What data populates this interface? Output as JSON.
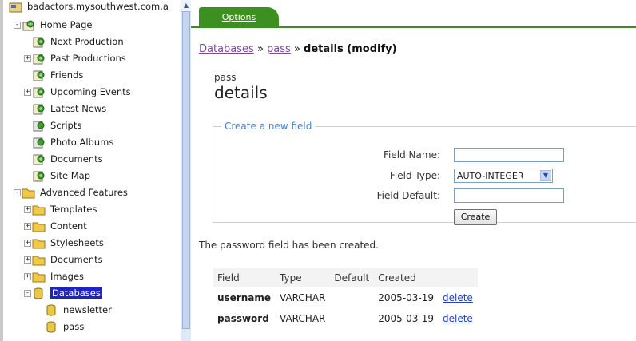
{
  "tree": {
    "items": [
      {
        "label": "badactors.mysouthwest.com.a",
        "indent": 0,
        "expander": "",
        "icon": "site",
        "selected": false
      },
      {
        "label": "Home Page",
        "indent": 1,
        "expander": "-",
        "icon": "home",
        "selected": false
      },
      {
        "label": "Next Production",
        "indent": 2,
        "expander": "",
        "icon": "page",
        "selected": false
      },
      {
        "label": "Past Productions",
        "indent": 2,
        "expander": "+",
        "icon": "page",
        "selected": false
      },
      {
        "label": "Friends",
        "indent": 2,
        "expander": "",
        "icon": "page",
        "selected": false
      },
      {
        "label": "Upcoming Events",
        "indent": 2,
        "expander": "+",
        "icon": "page",
        "selected": false
      },
      {
        "label": "Latest News",
        "indent": 2,
        "expander": "",
        "icon": "page",
        "selected": false
      },
      {
        "label": "Scripts",
        "indent": 2,
        "expander": "",
        "icon": "page-green",
        "selected": false
      },
      {
        "label": "Photo Albums",
        "indent": 2,
        "expander": "",
        "icon": "page-green",
        "selected": false
      },
      {
        "label": "Documents",
        "indent": 2,
        "expander": "",
        "icon": "page",
        "selected": false
      },
      {
        "label": "Site Map",
        "indent": 2,
        "expander": "",
        "icon": "page",
        "selected": false
      },
      {
        "label": "Advanced Features",
        "indent": 1,
        "expander": "-",
        "icon": "folder",
        "selected": false
      },
      {
        "label": "Templates",
        "indent": 2,
        "expander": "+",
        "icon": "folder",
        "selected": false
      },
      {
        "label": "Content",
        "indent": 2,
        "expander": "+",
        "icon": "folder",
        "selected": false
      },
      {
        "label": "Stylesheets",
        "indent": 2,
        "expander": "+",
        "icon": "folder",
        "selected": false
      },
      {
        "label": "Documents",
        "indent": 2,
        "expander": "+",
        "icon": "folder",
        "selected": false
      },
      {
        "label": "Images",
        "indent": 2,
        "expander": "+",
        "icon": "folder",
        "selected": false
      },
      {
        "label": "Databases",
        "indent": 2,
        "expander": "-",
        "icon": "database",
        "selected": true
      },
      {
        "label": "newsletter",
        "indent": 3,
        "expander": "",
        "icon": "database",
        "selected": false
      },
      {
        "label": "pass",
        "indent": 3,
        "expander": "",
        "icon": "database",
        "selected": false
      }
    ]
  },
  "tabs": {
    "options_label": "Options"
  },
  "breadcrumb": {
    "databases": "Databases",
    "sep1": " » ",
    "pass": "pass",
    "sep2": " » ",
    "current": "details (modify)"
  },
  "header": {
    "pretitle": "pass",
    "title": "details"
  },
  "new_field": {
    "legend": "Create a new field",
    "name_label": "Field Name:",
    "name_value": "",
    "type_label": "Field Type:",
    "type_value": "AUTO-INTEGER",
    "default_label": "Field Default:",
    "default_value": "",
    "create_label": "Create"
  },
  "status_message": "The password field has been created.",
  "fields_table": {
    "headers": [
      "Field",
      "Type",
      "Default",
      "Created"
    ],
    "rows": [
      {
        "field": "username",
        "type": "VARCHAR",
        "default": "",
        "created": "2005-03-19",
        "action": "delete"
      },
      {
        "field": "password",
        "type": "VARCHAR",
        "default": "",
        "created": "2005-03-19",
        "action": "delete"
      }
    ]
  },
  "colors": {
    "tab_green": "#3e8f22",
    "link_purple": "#7a4b93",
    "link_blue": "#2141c8",
    "legend_blue": "#4a7fd0",
    "selection": "#1f23c6"
  }
}
